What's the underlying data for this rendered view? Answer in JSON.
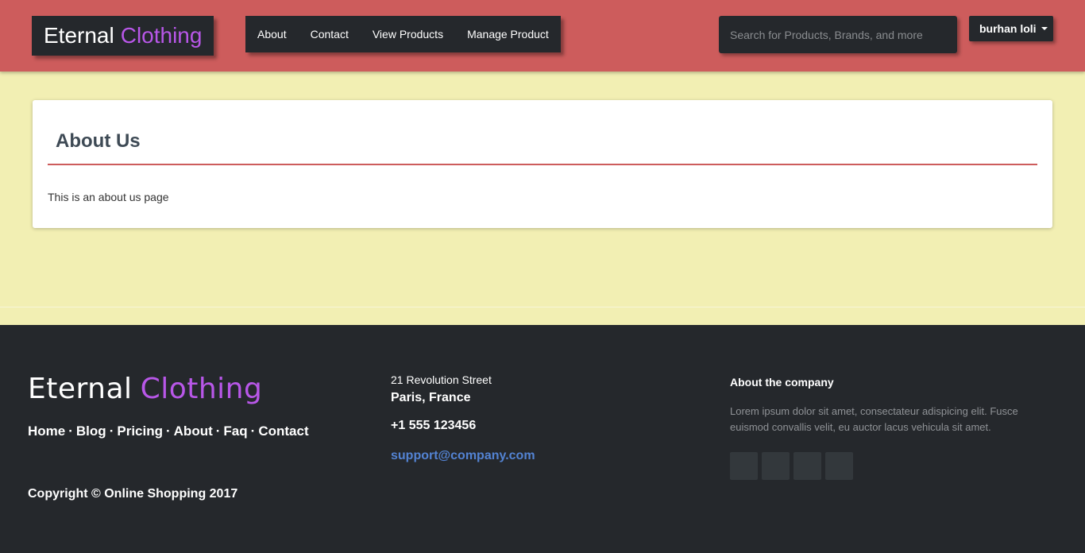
{
  "header": {
    "brand_main": "Eternal",
    "brand_accent": "Clothing",
    "nav": [
      "About",
      "Contact",
      "View Products",
      "Manage Product"
    ],
    "search_placeholder": "Search for Products, Brands, and more",
    "user_label": "burhan loli"
  },
  "main": {
    "title": "About Us",
    "text": "This is an about us page"
  },
  "footer": {
    "logo_main": "Eternal",
    "logo_accent": "Clothing",
    "links": [
      "Home",
      "Blog",
      "Pricing",
      "About",
      "Faq",
      "Contact"
    ],
    "separator": "·",
    "copyright": "Copyright © Online Shopping 2017",
    "street": "21 Revolution Street",
    "city": "Paris, France",
    "phone": "+1 555 123456",
    "email": "support@company.com",
    "about_title": "About the company",
    "about_text": "Lorem ipsum dolor sit amet, consectateur adispicing elit. Fusce euismod convallis velit, eu auctor lacus vehicula sit amet.",
    "social_icons": [
      "facebook-icon",
      "twitter-icon",
      "linkedin-icon",
      "github-icon"
    ]
  },
  "colors": {
    "header_bg": "#cd5c5c",
    "page_bg": "#f2efb3",
    "dark": "#25282c",
    "brand_accent": "#b857e8",
    "link_blue": "#5383d3"
  }
}
